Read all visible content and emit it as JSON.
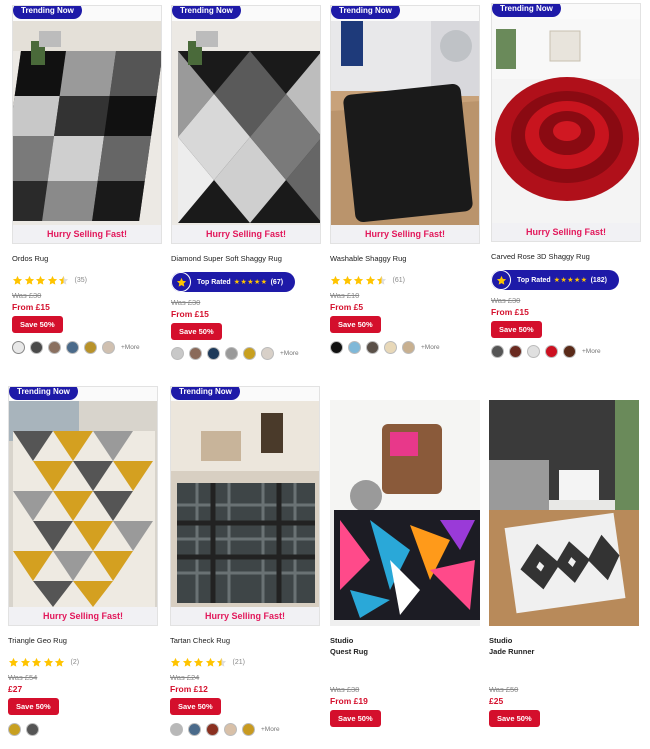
{
  "colors": {
    "trending": "#1e1aa8",
    "hurry": "#e2185b",
    "price": "#d40f2c",
    "star": "#ffc400"
  },
  "products": [
    {
      "trending": "Trending Now",
      "hurry": "Hurry Selling Fast!",
      "name": "Ordos Rug",
      "stars": 4.5,
      "reviews": "(35)",
      "was": "Was  £30",
      "price": "From £15",
      "save": "Save 50%",
      "more": "+More",
      "swatches": [
        "#e8e8e8",
        "#4a4a4a",
        "#8a7060",
        "#4a6a8a",
        "#b8922a",
        "#d0c0b0"
      ]
    },
    {
      "trending": "Trending Now",
      "hurry": "Hurry Selling Fast!",
      "name": "Diamond Super Soft Shaggy Rug",
      "top_rated": "Top Rated",
      "top_stars": "★★★★★",
      "top_count": "(67)",
      "was": "Was  £30",
      "price": "From £15",
      "save": "Save 50%",
      "more": "+More",
      "swatches": [
        "#c8c8c8",
        "#8a6a5a",
        "#1e3a5a",
        "#9a9a9a",
        "#c8a020",
        "#d8d0c8"
      ]
    },
    {
      "trending": "Trending Now",
      "hurry": "Hurry Selling Fast!",
      "name": "Washable Shaggy Rug",
      "stars": 4.5,
      "reviews": "(61)",
      "was": "Was  £10",
      "price": "From £5",
      "save": "Save 50%",
      "more": "+More",
      "swatches": [
        "#111111",
        "#7fb8d8",
        "#5a5048",
        "#e8d8b8",
        "#c8b090"
      ]
    },
    {
      "trending": "Trending Now",
      "hurry": "Hurry Selling Fast!",
      "name": "Carved Rose 3D Shaggy Rug",
      "top_rated": "Top Rated",
      "top_stars": "★★★★★",
      "top_count": "(182)",
      "was": "Was  £30",
      "price": "From £15",
      "save": "Save 50%",
      "more": "+More",
      "swatches": [
        "#555555",
        "#6a2a20",
        "#e0e0e0",
        "#cc1020",
        "#5a2a18"
      ]
    },
    {
      "trending": "Trending Now",
      "hurry": "Hurry Selling Fast!",
      "name": "Triangle Geo Rug",
      "stars": 5,
      "reviews": "(2)",
      "was": "Was  £54",
      "price": "£27",
      "save": "Save 50%",
      "swatches": [
        "#c8a020",
        "#555555"
      ]
    },
    {
      "trending": "Trending Now",
      "hurry": "Hurry Selling Fast!",
      "name": "Tartan Check Rug",
      "stars": 4.5,
      "reviews": "(21)",
      "was": "Was  £24",
      "price": "From £12",
      "save": "Save 50%",
      "more": "+More",
      "swatches": [
        "#b8b8b8",
        "#4a6a8a",
        "#8a3020",
        "#d8c0a8",
        "#c89a20"
      ]
    },
    {
      "brand": "Studio",
      "name": "Quest Rug",
      "was": "Was  £38",
      "price": "From £19",
      "save": "Save 50%"
    },
    {
      "brand": "Studio",
      "name": "Jade Runner",
      "was": "Was  £50",
      "price": "£25",
      "save": "Save 50%"
    }
  ]
}
